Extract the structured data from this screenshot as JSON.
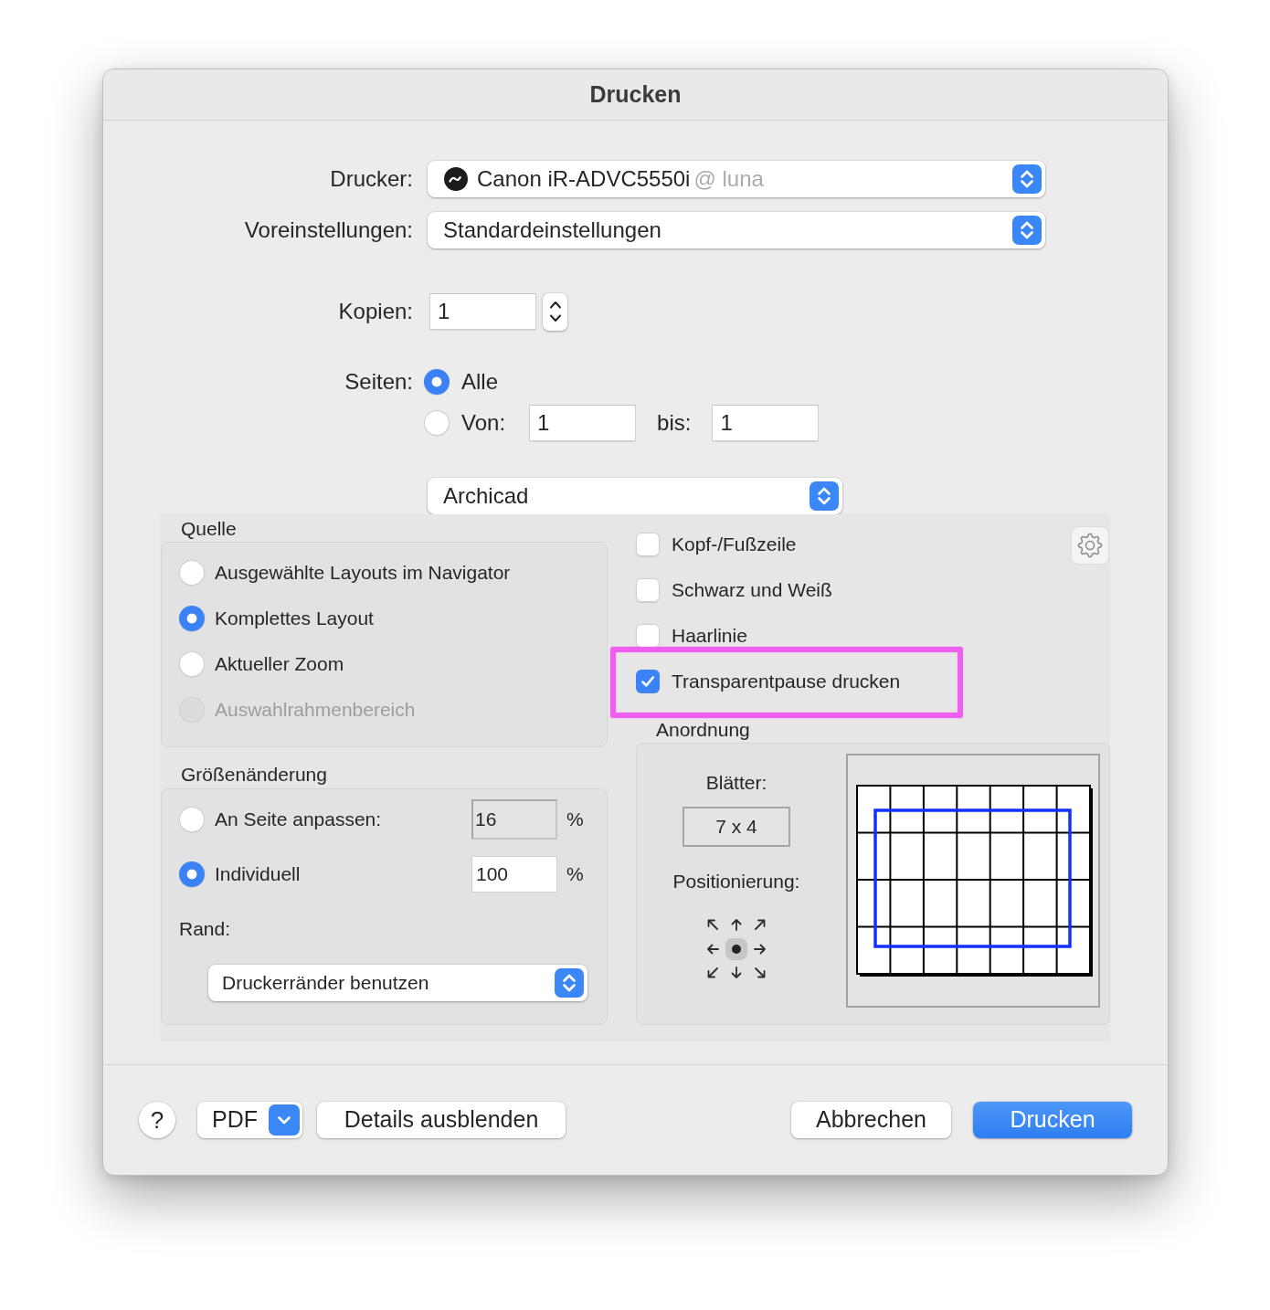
{
  "window": {
    "title": "Drucken"
  },
  "printer": {
    "label": "Drucker:",
    "name": "Canon iR-ADVC5550i",
    "location": "@ luna"
  },
  "presets": {
    "label": "Voreinstellungen:",
    "value": "Standardeinstellungen"
  },
  "copies": {
    "label": "Kopien:",
    "value": "1"
  },
  "pages": {
    "label": "Seiten:",
    "options": [
      {
        "kind": "all",
        "label": "Alle",
        "selected": true
      },
      {
        "kind": "range",
        "label": "Von:",
        "selected": false,
        "from": "1",
        "to_label": "bis:",
        "to": "1"
      }
    ]
  },
  "section_menu": {
    "value": "Archicad"
  },
  "source": {
    "title": "Quelle",
    "options": [
      {
        "label": "Ausgewählte Layouts im Navigator",
        "selected": false,
        "disabled": false
      },
      {
        "label": "Komplettes Layout",
        "selected": true,
        "disabled": false
      },
      {
        "label": "Aktueller Zoom",
        "selected": false,
        "disabled": false
      },
      {
        "label": "Auswahlrahmenbereich",
        "selected": false,
        "disabled": true
      }
    ]
  },
  "checkboxes": [
    {
      "label": "Kopf-/Fußzeile",
      "checked": false,
      "highlighted": false
    },
    {
      "label": "Schwarz und Weiß",
      "checked": false,
      "highlighted": false
    },
    {
      "label": "Haarlinie",
      "checked": false,
      "highlighted": false
    },
    {
      "label": "Transparentpause drucken",
      "checked": true,
      "highlighted": true
    }
  ],
  "resize": {
    "title": "Größenänderung",
    "options": [
      {
        "label": "An Seite anpassen:",
        "selected": false,
        "value": "16",
        "unit": "%"
      },
      {
        "label": "Individuell",
        "selected": true,
        "value": "100",
        "unit": "%"
      }
    ],
    "margin": {
      "label": "Rand:",
      "value": "Druckerränder benutzen"
    }
  },
  "arrangement": {
    "title": "Anordnung",
    "sheets_label": "Blätter:",
    "sheets": "7 x 4",
    "positioning_label": "Positionierung:"
  },
  "footer": {
    "help": "?",
    "pdf": "PDF",
    "details": "Details ausblenden",
    "cancel": "Abbrechen",
    "print": "Drucken"
  }
}
